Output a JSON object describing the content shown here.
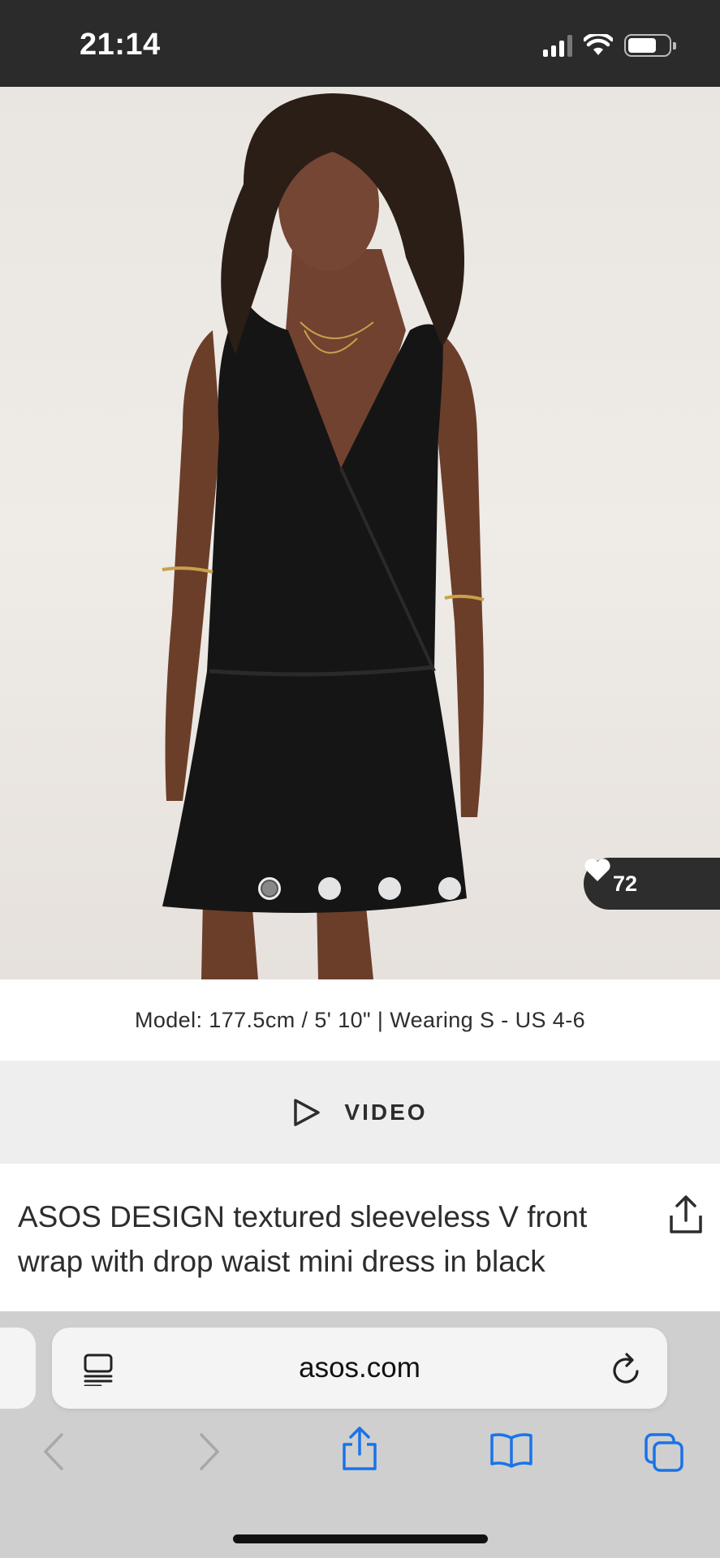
{
  "status_bar": {
    "time": "21:14",
    "icons": [
      "cellular-signal-icon",
      "wifi-icon",
      "battery-icon"
    ]
  },
  "product_gallery": {
    "image_description_icon": "model-photo",
    "dots": {
      "count": 4,
      "active_index": 0
    },
    "saves_count": "72",
    "saves_icon": "heart-icon"
  },
  "model_info": "Model: 177.5cm / 5' 10\" | Wearing S - US 4-6",
  "video_button": {
    "label": "VIDEO",
    "icon": "play-icon"
  },
  "product": {
    "title": "ASOS DESIGN textured sleeveless V front wrap with drop waist mini dress in black",
    "share_icon": "share-icon"
  },
  "browser": {
    "url": "asos.com",
    "page_menu_icon": "page-menu-icon",
    "reload_icon": "reload-icon",
    "toolbar": [
      "back-icon",
      "forward-icon",
      "share-icon",
      "bookmarks-icon",
      "tabs-icon"
    ],
    "accent_color": "#1a73e8",
    "disabled_color": "#a8a8a8"
  }
}
